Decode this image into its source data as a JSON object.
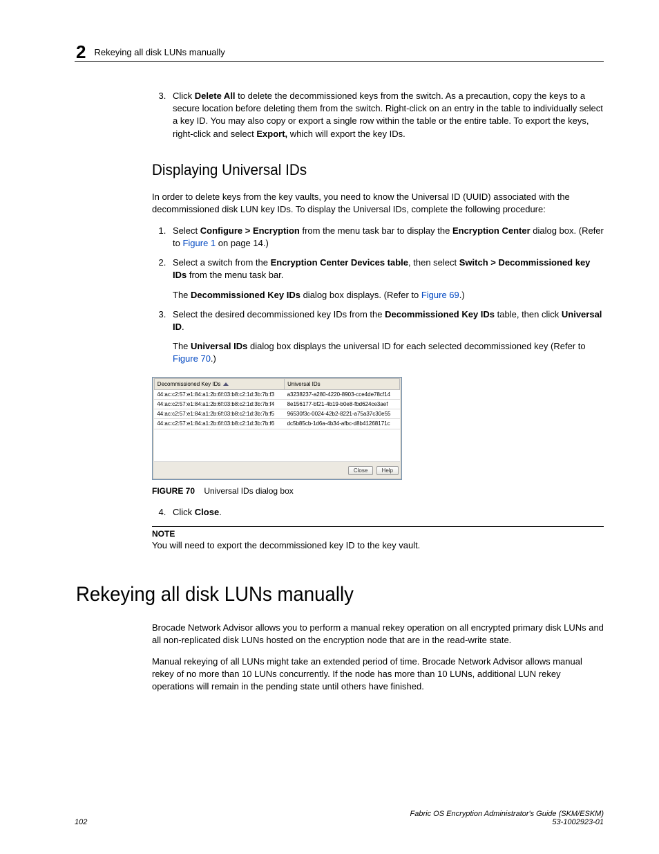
{
  "header": {
    "chapter_number": "2",
    "running_title": "Rekeying all disk LUNs manually"
  },
  "step3_prior": {
    "num": "3.",
    "text_pre": "Click ",
    "bold1": "Delete All",
    "text_mid": " to delete the decommissioned keys from the switch. As a precaution, copy the keys to a secure location before deleting them from the switch. Right-click on an entry in the table to individually select a key ID. You may also copy or export a single row within the table or the entire table. To export the keys, right-click and select ",
    "bold2": "Export,",
    "text_end": " which will export the key IDs."
  },
  "section_h2": "Displaying Universal IDs",
  "uuid_intro": "In order to delete keys from the key vaults, you need to know the Universal ID (UUID) associated with the decommissioned disk LUN key IDs. To display the Universal IDs, complete the following procedure:",
  "steps": [
    {
      "pre": "Select ",
      "b1": "Configure > Encryption",
      "mid1": " from the menu task bar to display the ",
      "b2": "Encryption Center",
      "mid2": " dialog box. (Refer to ",
      "link": "Figure 1",
      "mid3": " on page 14.)"
    },
    {
      "pre": "Select a switch from the ",
      "b1": "Encryption Center Devices table",
      "mid1": ", then select ",
      "b2": "Switch > Decommissioned key IDs",
      "mid2": " from the menu task bar.",
      "sub_pre": "The ",
      "sub_b1": "Decommissioned Key IDs",
      "sub_mid": " dialog box displays. (Refer to ",
      "sub_link": "Figure 69",
      "sub_end": ".)"
    },
    {
      "pre": "Select the desired decommissioned key IDs from the ",
      "b1": "Decommissioned Key IDs",
      "mid1": " table, then click ",
      "b2": "Universal ID",
      "mid2": ".",
      "sub_pre": "The ",
      "sub_b1": "Universal IDs",
      "sub_mid": " dialog box displays the universal ID for each selected decommissioned key (Refer to ",
      "sub_link": "Figure 70",
      "sub_end": ".)"
    }
  ],
  "dialog": {
    "col1": "Decommissioned Key IDs",
    "col2": "Universal IDs",
    "rows": [
      {
        "k": "44:ac:c2:57:e1:84:a1:2b:6f:03:b8:c2:1d:3b:7b:f3",
        "u": "a3238237-a280-4220-8903-cce4de78cf14"
      },
      {
        "k": "44:ac:c2:57:e1:84:a1:2b:6f:03:b8:c2:1d:3b:7b:f4",
        "u": "8e156177-bf21-4b19-b0e8-fbd624ce3aef"
      },
      {
        "k": "44:ac:c2:57:e1:84:a1:2b:6f:03:b8:c2:1d:3b:7b:f5",
        "u": "96530f3c-0024-42b2-8221-a75a37c30e55"
      },
      {
        "k": "44:ac:c2:57:e1:84:a1:2b:6f:03:b8:c2:1d:3b:7b:f6",
        "u": "dc5b85cb-1d6a-4b34-afbc-d8b41268171c"
      }
    ],
    "btn_close": "Close",
    "btn_help": "Help"
  },
  "figure_caption": {
    "num": "FIGURE 70",
    "text": "Universal IDs dialog box"
  },
  "step4": {
    "pre": "Click ",
    "b": "Close",
    "end": "."
  },
  "note": {
    "label": "NOTE",
    "text": "You will need to export the decommissioned key ID to the key vault."
  },
  "h1": "Rekeying all disk LUNs manually",
  "para_a": "Brocade Network Advisor allows you to perform a manual rekey operation on all encrypted primary disk LUNs and all non-replicated disk LUNs hosted on the encryption node that are in the read-write state.",
  "para_b": "Manual rekeying of all LUNs might take an extended period of time. Brocade Network Advisor allows manual rekey of no more than 10 LUNs concurrently. If the node has more than 10 LUNs, additional LUN rekey operations will remain in the pending state until others have finished.",
  "footer": {
    "page_number": "102",
    "book_title": "Fabric OS Encryption Administrator's Guide (SKM/ESKM)",
    "part_number": "53-1002923-01"
  }
}
